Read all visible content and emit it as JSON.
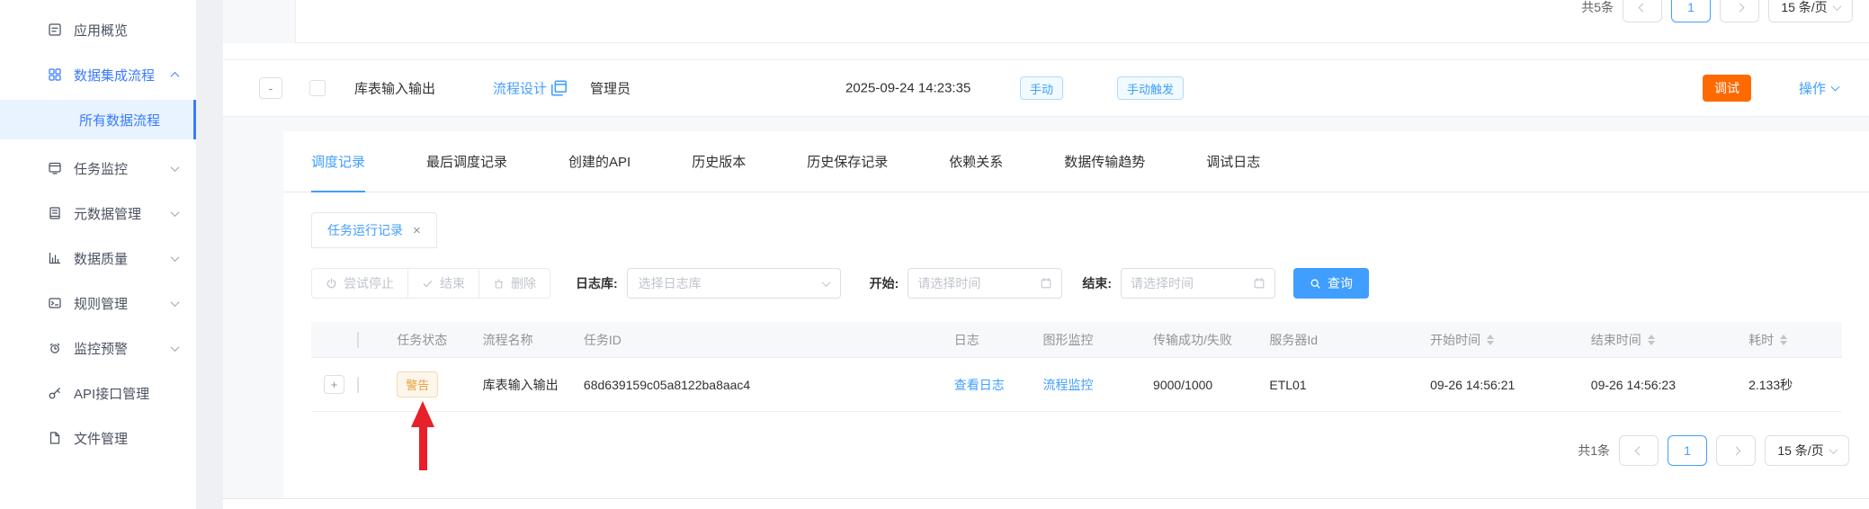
{
  "colors": {
    "accent": "#409eff",
    "sidebar_active": "#3a7bfd",
    "warning_text": "#e6a23c",
    "warning_bg": "#fdf6ec",
    "debug_orange": "#ff6a00",
    "arrow_red": "#e8202a",
    "section_bg": "#f7f8fa"
  },
  "sidebar": {
    "items": [
      {
        "label": "应用概览",
        "icon": "overview-icon"
      },
      {
        "label": "数据集成流程",
        "icon": "integration-icon"
      },
      {
        "label": "所有数据流程"
      },
      {
        "label": "任务监控",
        "icon": "task-monitor-icon"
      },
      {
        "label": "元数据管理",
        "icon": "metadata-icon"
      },
      {
        "label": "数据质量",
        "icon": "data-quality-icon"
      },
      {
        "label": "规则管理",
        "icon": "rules-icon"
      },
      {
        "label": "监控预警",
        "icon": "alarm-icon"
      },
      {
        "label": "API接口管理",
        "icon": "api-icon"
      },
      {
        "label": "文件管理",
        "icon": "file-icon"
      }
    ]
  },
  "top_pagination": {
    "total": "共5条",
    "page": "1",
    "page_size": "15 条/页"
  },
  "flow_row": {
    "expander": "-",
    "name": "库表输入输出",
    "design_link": "流程设计",
    "owner": "管理员",
    "created_at": "2025-09-24 14:23:35",
    "tag_mode": "手动",
    "tag_trigger": "手动触发",
    "debug_button": "调试",
    "action_menu": "操作"
  },
  "tabs": {
    "items": [
      "调度记录",
      "最后调度记录",
      "创建的API",
      "历史版本",
      "历史保存记录",
      "依赖关系",
      "数据传输趋势",
      "调试日志"
    ],
    "active": "调度记录"
  },
  "subtab": {
    "label": "任务运行记录",
    "close": "×"
  },
  "toolbar": {
    "stop_button": "尝试停止",
    "finish_button": "结束",
    "delete_button": "删除",
    "log_store_label": "日志库:",
    "log_store_placeholder": "选择日志库",
    "start_label": "开始:",
    "start_placeholder": "请选择时间",
    "end_label": "结束:",
    "end_placeholder": "请选择时间",
    "query_button": "查询"
  },
  "run_table": {
    "headers": {
      "status": "任务状态",
      "flow_name": "流程名称",
      "task_id": "任务ID",
      "log": "日志",
      "graph": "图形监控",
      "transfer": "传输成功/失败",
      "server": "服务器Id",
      "start_time": "开始时间",
      "end_time": "结束时间",
      "duration": "耗时"
    },
    "row": {
      "expander": "+",
      "status": "警告",
      "flow_name": "库表输入输出",
      "task_id": "68d639159c05a8122ba8aac4",
      "log_link": "查看日志",
      "graph_link": "流程监控",
      "transfer": "9000/1000",
      "server": "ETL01",
      "start_time": "09-26 14:56:21",
      "end_time": "09-26 14:56:23",
      "duration": "2.133秒"
    }
  },
  "bottom_pagination": {
    "total": "共1条",
    "page": "1",
    "page_size": "15 条/页"
  }
}
